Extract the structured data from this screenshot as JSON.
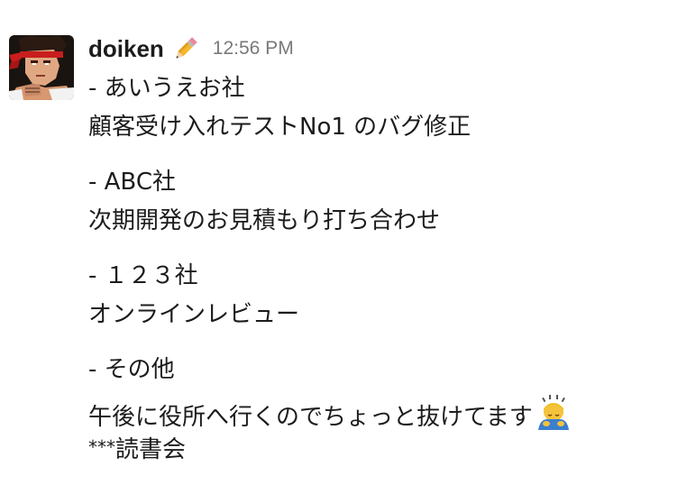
{
  "message": {
    "username": "doiken",
    "status_emoji": "pencil-emoji",
    "timestamp": "12:56 PM",
    "avatar": "fighter-avatar",
    "lines": [
      "- あいうえお社",
      "顧客受け入れテストNo1 のバグ修正",
      "- ABC社",
      "次期開発のお見積もり打ち合わせ",
      "- １２３社",
      "オンラインレビュー",
      "- その他",
      "午後に役所へ行くのでちょっと抜けてます",
      "***",
      "読書会"
    ],
    "trailing_emoji": "person-bowing-emoji",
    "colors": {
      "text": "#1d1c1d",
      "timestamp": "#7a797a",
      "background": "#ffffff"
    }
  }
}
